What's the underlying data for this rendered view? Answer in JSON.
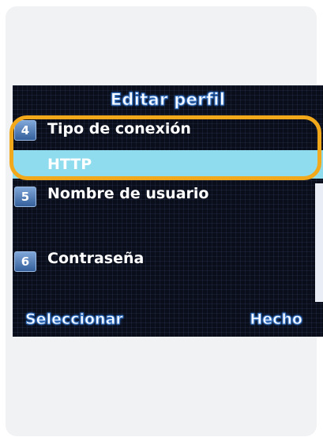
{
  "screen": {
    "title": "Editar perfil",
    "items": [
      {
        "number": "4",
        "label": "Tipo de conexión",
        "value": "HTTP"
      },
      {
        "number": "5",
        "label": "Nombre de usuario"
      },
      {
        "number": "6",
        "label": "Contraseña"
      }
    ]
  },
  "softkeys": {
    "left": "Seleccionar",
    "right": "Hecho"
  },
  "colors": {
    "highlight_ring": "#f2a81b",
    "selected_value_bg": "#8fdcee",
    "screen_bg": "#0a0e1a",
    "number_icon": "#4a76b2"
  }
}
